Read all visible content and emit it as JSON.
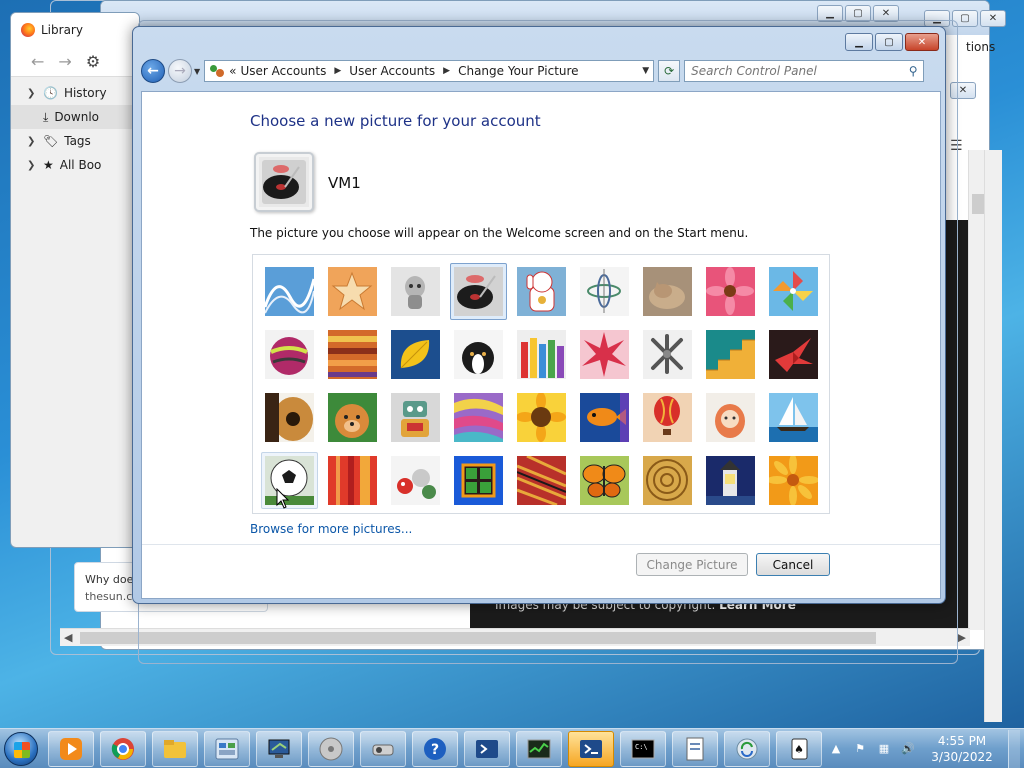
{
  "library_window": {
    "title": "Library",
    "items": [
      {
        "label": "History",
        "icon": "clock-icon"
      },
      {
        "label": "Downlo",
        "icon": "download-icon"
      },
      {
        "label": "Tags",
        "icon": "tag-icon"
      },
      {
        "label": "All Boo",
        "icon": "star-icon"
      }
    ]
  },
  "background_browser": {
    "menu_partial": "tions",
    "copyright_text": "Images may be subject to copyright.",
    "learn_more": "Learn More",
    "card_title": "Why doe",
    "card_source": "thesun.co"
  },
  "control_panel": {
    "breadcrumbs": [
      "User Accounts",
      "User Accounts",
      "Change Your Picture"
    ],
    "breadcrumb_prefix": "«",
    "search_placeholder": "Search Control Panel",
    "heading": "Choose a new picture for your account",
    "user_name": "VM1",
    "description": "The picture you choose will appear on the Welcome screen and on the Start menu.",
    "pictures": [
      "rollercoaster",
      "starfish",
      "robot-dog",
      "turntable",
      "lucky-cat",
      "gyroscope",
      "kitten",
      "pink-flower",
      "pinwheel",
      "ball",
      "fabric",
      "yellow-leaf",
      "dog",
      "crayons",
      "red-star",
      "jacks",
      "stairs",
      "paper-crane",
      "guitar",
      "puppy",
      "toy-robot",
      "scarves",
      "sunflower",
      "fish",
      "hot-air-balloon",
      "doll",
      "sailboat",
      "soccer-ball",
      "curtain",
      "marbles",
      "window",
      "woven-fabric",
      "butterfly",
      "wicker-ball",
      "lighthouse",
      "orange-flower"
    ],
    "selected_picture": "turntable",
    "browse_link": "Browse for more pictures...",
    "change_button": "Change Picture",
    "cancel_button": "Cancel"
  },
  "taskbar": {
    "apps": [
      "media-player",
      "chrome",
      "file-explorer",
      "control-panel",
      "remote-desktop",
      "disk",
      "projector",
      "help",
      "powershell",
      "task-manager",
      "powershell-active",
      "command-prompt",
      "document",
      "sync",
      "solitaire"
    ],
    "time": "4:55 PM",
    "date": "3/30/2022"
  }
}
